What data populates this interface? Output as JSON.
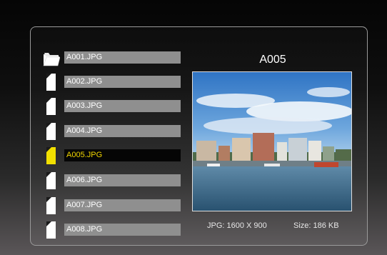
{
  "files": [
    {
      "name": "A001.JPG",
      "icon": "folder-icon",
      "selected": false
    },
    {
      "name": "A002.JPG",
      "icon": "file-icon",
      "selected": false
    },
    {
      "name": "A003.JPG",
      "icon": "file-icon",
      "selected": false
    },
    {
      "name": "A004.JPG",
      "icon": "file-icon",
      "selected": false
    },
    {
      "name": "A005.JPG",
      "icon": "file-icon",
      "selected": true
    },
    {
      "name": "A006.JPG",
      "icon": "file-icon",
      "selected": false
    },
    {
      "name": "A007.JPG",
      "icon": "file-icon",
      "selected": false
    },
    {
      "name": "A008.JPG",
      "icon": "file-icon",
      "selected": false
    }
  ],
  "preview": {
    "title": "A005",
    "format_resolution": "JPG: 1600 X 900",
    "size": "Size: 186 KB"
  },
  "colors": {
    "selected_text": "#f2d600",
    "selected_icon": "#f2e000",
    "row_bar": "#8f8f8f"
  }
}
